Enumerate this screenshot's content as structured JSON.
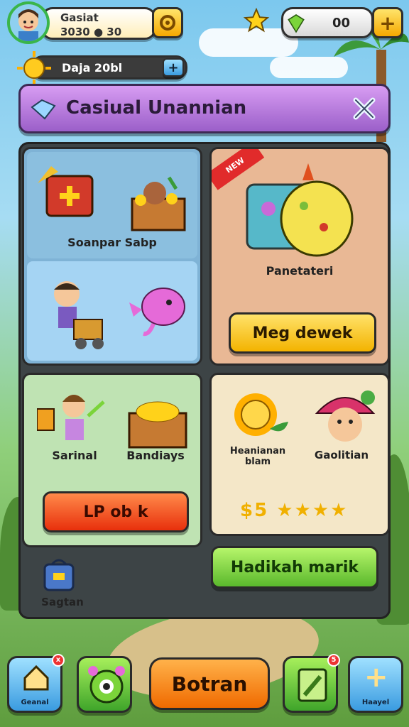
{
  "player": {
    "name": "Gasiat",
    "coins_text": "3030",
    "coins_suffix": "30"
  },
  "currency": {
    "gems": "00",
    "coin_bar": "Daja 20bl"
  },
  "title": "Casiual Unannian",
  "cards": {
    "card1": {
      "label": "Soanpar Sabp"
    },
    "card2": {
      "badge": "NEW",
      "label": "Panetateri",
      "button": "Meg dewek"
    },
    "card3": {
      "label_left": "Sarinal",
      "label_right": "Bandiays",
      "button": "LP ob k"
    },
    "card4": {
      "label_left": "Heanianan blam",
      "label_right": "Gaolitian",
      "stars": "$5 ★★★★"
    },
    "green_button": "Hadikah marik",
    "bag_label": "Sagtan"
  },
  "bottom_nav": {
    "left_label": "Geanal",
    "center_label": "Botran",
    "right_label": "Haayel",
    "badge_left": "x",
    "badge_right": "5"
  },
  "colors": {
    "accent_purple": "#9b5fc9",
    "orange": "#f06a00",
    "green": "#5ab82c",
    "yellow": "#f3b300"
  }
}
